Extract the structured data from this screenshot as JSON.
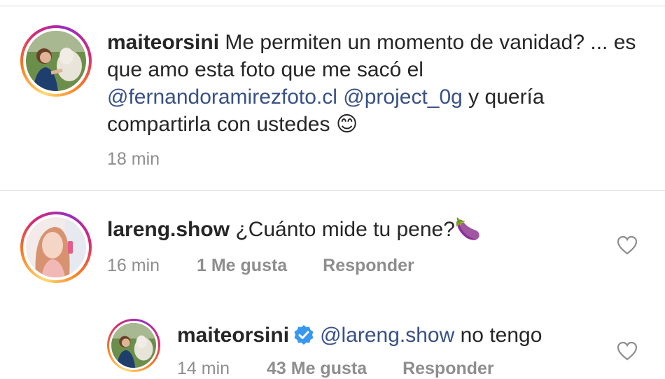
{
  "caption": {
    "username": "maiteorsini",
    "text_before": " Me permiten un momento de vanidad? ... es que amo esta foto que me sacó el ",
    "mention_1": "@fernandoramirezfoto.cl",
    "space": " ",
    "mention_2": "@project_0g",
    "text_after": " y quería compartirla con ustedes ",
    "emoji": "😊",
    "time": "18 min"
  },
  "comment": {
    "username": "lareng.show",
    "text": " ¿Cuánto mide tu pene?",
    "emoji": "🍆",
    "time": "16 min",
    "likes": "1 Me gusta",
    "reply_label": "Responder"
  },
  "reply": {
    "username": "maiteorsini",
    "mention": "@lareng.show",
    "text": " no tengo",
    "time": "14 min",
    "likes": "43 Me gusta",
    "reply_label": "Responder"
  },
  "colors": {
    "text": "#262626",
    "muted": "#8e8e8e",
    "mention": "#385185",
    "verified": "#3897f0",
    "divider": "#dbdbdb"
  }
}
